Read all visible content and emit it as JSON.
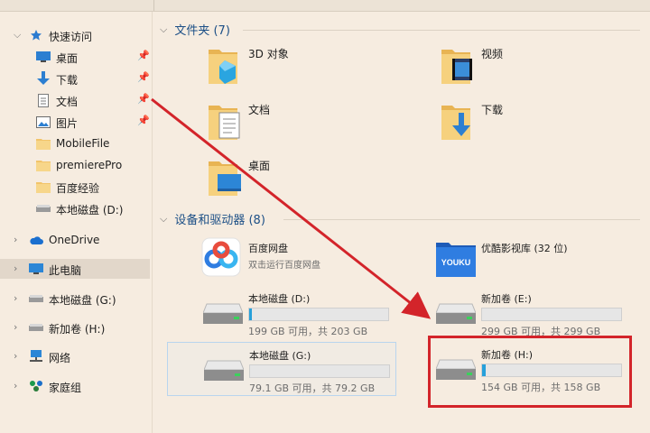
{
  "sidebar": {
    "quick_access": "快速访问",
    "pinned": [
      {
        "label": "桌面",
        "icon": "desktop-icon"
      },
      {
        "label": "下载",
        "icon": "download-icon"
      },
      {
        "label": "文档",
        "icon": "document-icon"
      },
      {
        "label": "图片",
        "icon": "pictures-icon"
      }
    ],
    "folders": [
      "MobileFile",
      "premierePro",
      "百度经验"
    ],
    "local_disk_d": "本地磁盘 (D:)",
    "onedrive": "OneDrive",
    "this_pc": "此电脑",
    "local_disk_g": "本地磁盘 (G:)",
    "new_volume_h": "新加卷 (H:)",
    "network": "网络",
    "homegroup": "家庭组"
  },
  "content": {
    "folders_header": "文件夹 (7)",
    "folders": [
      {
        "name": "3D 对象",
        "icon": "3d-objects-folder-icon"
      },
      {
        "name": "视频",
        "icon": "videos-folder-icon"
      },
      {
        "name": "文档",
        "icon": "documents-folder-icon"
      },
      {
        "name": "下载",
        "icon": "downloads-folder-icon"
      },
      {
        "name": "桌面",
        "icon": "desktop-folder-icon"
      }
    ],
    "devices_header": "设备和驱动器 (8)",
    "apps": [
      {
        "name": "百度网盘",
        "desc": "双击运行百度网盘",
        "icon": "baidu-netdisk-icon"
      },
      {
        "name": "优酷影视库 (32 位)",
        "desc": "",
        "icon": "youku-icon",
        "logo_text": "YOUKU"
      }
    ],
    "drives": [
      {
        "name": "本地磁盘 (D:)",
        "size": "199 GB 可用，共 203 GB",
        "used": 0.02
      },
      {
        "name": "新加卷 (E:)",
        "size": "299 GB 可用，共 299 GB",
        "used": 0.0
      },
      {
        "name": "本地磁盘 (G:)",
        "size": "79.1 GB 可用，共 79.2 GB",
        "used": 0.0
      },
      {
        "name": "新加卷 (H:)",
        "size": "154 GB 可用，共 158 GB",
        "used": 0.025
      }
    ]
  },
  "colors": {
    "accent": "#26a0da",
    "highlight": "#d3242a",
    "arrow": "#d3242a",
    "header": "#1c4f86"
  }
}
